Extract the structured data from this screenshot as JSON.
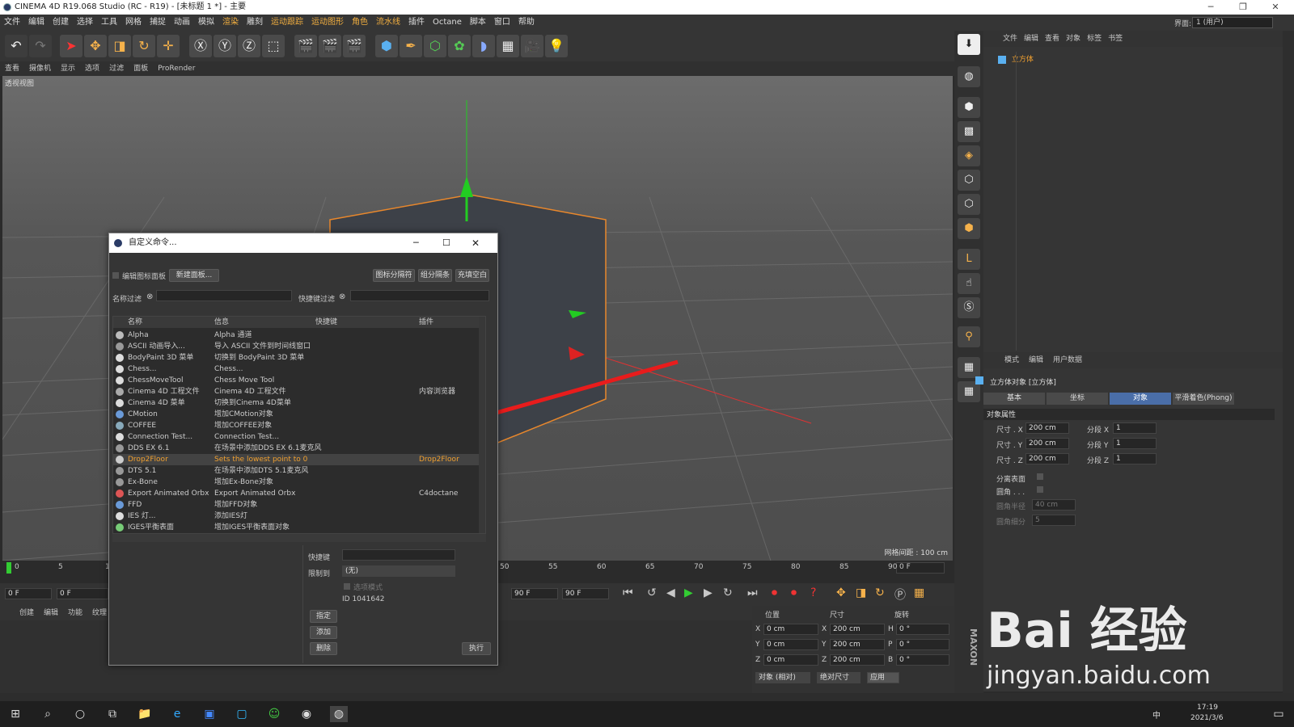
{
  "window": {
    "title": "CINEMA 4D R19.068 Studio (RC - R19) - [未标题 1 *] - 主要",
    "layout_label": "界面:",
    "layout_value": "1 (用户)"
  },
  "menu": [
    "文件",
    "编辑",
    "创建",
    "选择",
    "工具",
    "网格",
    "捕捉",
    "动画",
    "模拟",
    "渲染",
    "雕刻",
    "运动跟踪",
    "运动图形",
    "角色",
    "流水线",
    "插件",
    "Octane",
    "脚本",
    "窗口",
    "帮助"
  ],
  "viewport_menu": [
    "查看",
    "摄像机",
    "显示",
    "选项",
    "过滤",
    "面板",
    "ProRender"
  ],
  "viewport": {
    "label": "透视视图",
    "grid_spacing": "网格间距 : 100 cm"
  },
  "object_manager": {
    "menu": [
      "文件",
      "编辑",
      "查看",
      "对象",
      "标签",
      "书签"
    ],
    "object_name": "立方体"
  },
  "attribute_manager": {
    "menu": [
      "模式",
      "编辑",
      "用户数据"
    ],
    "title": "立方体对象 [立方体]",
    "tabs": [
      "基本",
      "坐标",
      "对象",
      "平滑着色(Phong)"
    ],
    "section": "对象属性",
    "rows": [
      {
        "label": "尺寸 . X",
        "value": "200 cm",
        "seg_label": "分段 X",
        "seg": "1"
      },
      {
        "label": "尺寸 . Y",
        "value": "200 cm",
        "seg_label": "分段 Y",
        "seg": "1"
      },
      {
        "label": "尺寸 . Z",
        "value": "200 cm",
        "seg_label": "分段 Z",
        "seg": "1"
      }
    ],
    "sep_label": "分离表面",
    "fillet_label": "圆角 . . .",
    "fillet_radius_label": "圆角半径",
    "fillet_radius": "40 cm",
    "fillet_sub_label": "圆角细分",
    "fillet_sub": "5"
  },
  "timeline": {
    "ticks": [
      "0",
      "5",
      "10",
      "50",
      "55",
      "60",
      "65",
      "70",
      "75",
      "80",
      "85",
      "90"
    ],
    "current": "0 F",
    "start": "0 F",
    "end": "90 F",
    "end2": "90 F",
    "frame_box": "0 F"
  },
  "material_menu": [
    "创建",
    "编辑",
    "功能",
    "纹理"
  ],
  "coords": {
    "headers": [
      "位置",
      "尺寸",
      "旋转"
    ],
    "rows": [
      {
        "axis": "X",
        "pos": "0 cm",
        "size_axis": "X",
        "size": "200 cm",
        "rot_axis": "H",
        "rot": "0 °"
      },
      {
        "axis": "Y",
        "pos": "0 cm",
        "size_axis": "Y",
        "size": "200 cm",
        "rot_axis": "P",
        "rot": "0 °"
      },
      {
        "axis": "Z",
        "pos": "0 cm",
        "size_axis": "Z",
        "size": "200 cm",
        "rot_axis": "B",
        "rot": "0 °"
      }
    ],
    "mode": "对象 (相对)",
    "size_mode": "绝对尺寸",
    "apply": "应用"
  },
  "dialog": {
    "title": "自定义命令...",
    "edit_panel": "编辑图标面板",
    "new_panel": "新建面板...",
    "btn_sep": "图标分隔符",
    "btn_group": "组分隔条",
    "btn_fill": "充填空白",
    "name_filter": "名称过滤",
    "shortcut_filter": "快捷键过滤",
    "columns": [
      "名称",
      "信息",
      "快捷键",
      "插件"
    ],
    "rows": [
      {
        "name": "Alpha",
        "info": "Alpha 通道",
        "plugin": "",
        "icon": "#bbb"
      },
      {
        "name": "ASCII 动画导入...",
        "info": "导入 ASCII 文件到时间线窗口",
        "plugin": "",
        "icon": "#999"
      },
      {
        "name": "BodyPaint 3D 菜单",
        "info": "切换到 BodyPaint 3D 菜单",
        "plugin": "",
        "icon": "#ddd"
      },
      {
        "name": "Chess...",
        "info": "Chess...",
        "plugin": "",
        "icon": "#ddd"
      },
      {
        "name": "ChessMoveTool",
        "info": "Chess Move Tool",
        "plugin": "",
        "icon": "#ddd"
      },
      {
        "name": "Cinema 4D 工程文件",
        "info": "Cinema 4D 工程文件",
        "plugin": "内容浏览器",
        "icon": "#aaa"
      },
      {
        "name": "Cinema 4D 菜单",
        "info": "切换到Cinema 4D菜单",
        "plugin": "",
        "icon": "#ddd"
      },
      {
        "name": "CMotion",
        "info": "增加CMotion对象",
        "plugin": "",
        "icon": "#6a9ad8"
      },
      {
        "name": "COFFEE",
        "info": "增加COFFEE对象",
        "plugin": "",
        "icon": "#8ab"
      },
      {
        "name": "Connection Test...",
        "info": "Connection Test...",
        "plugin": "",
        "icon": "#ddd"
      },
      {
        "name": "DDS EX 6.1",
        "info": "在场景中添加DDS EX 6.1麦克风",
        "plugin": "",
        "icon": "#999"
      },
      {
        "name": "Drop2Floor",
        "info": "Sets the lowest point to 0",
        "plugin": "Drop2Floor",
        "icon": "#ccc"
      },
      {
        "name": "DTS 5.1",
        "info": "在场景中添加DTS 5.1麦克风",
        "plugin": "",
        "icon": "#999"
      },
      {
        "name": "Ex-Bone",
        "info": "增加Ex-Bone对象",
        "plugin": "",
        "icon": "#999"
      },
      {
        "name": "Export Animated Orbx",
        "info": "Export Animated Orbx",
        "plugin": "C4doctane",
        "icon": "#d55"
      },
      {
        "name": "FFD",
        "info": "增加FFD对象",
        "plugin": "",
        "icon": "#6a9ad8"
      },
      {
        "name": "IES 灯...",
        "info": "添加IES灯",
        "plugin": "",
        "icon": "#ddd"
      },
      {
        "name": "IGES平衡表面",
        "info": "增加IGES平衡表面对象",
        "plugin": "",
        "icon": "#7c7"
      }
    ],
    "shortcut_label": "快捷键",
    "restrict_label": "限制到",
    "restrict_value": "(无)",
    "option_mode": "选项模式",
    "id": "ID 1041642",
    "btn_assign": "指定",
    "btn_add": "添加",
    "btn_delete": "删除",
    "btn_exec": "执行"
  },
  "taskbar": {
    "time": "17:19",
    "date": "2021/3/6",
    "ime": "中"
  },
  "watermark": {
    "text": "Bai 经验",
    "sub": "jingyan.baidu.com"
  },
  "colors": {
    "accent": "#f0a030",
    "tab_active": "#4a6ea8",
    "arrow": "#e02020"
  }
}
